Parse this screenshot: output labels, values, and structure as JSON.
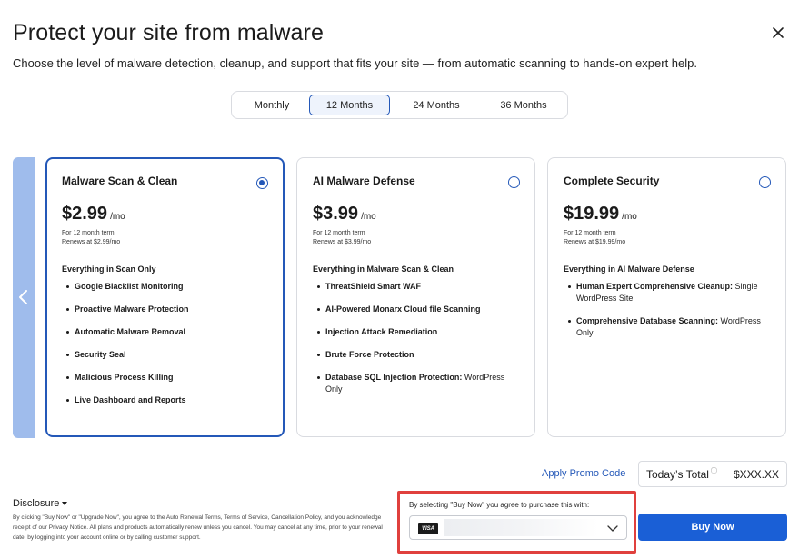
{
  "header": {
    "title": "Protect your site from malware",
    "subtitle": "Choose the level of malware detection, cleanup, and support that fits your site — from automatic scanning to hands-on expert help.",
    "close_icon": "close-icon"
  },
  "terms": {
    "tabs": [
      {
        "label": "Monthly"
      },
      {
        "label": "12 Months"
      },
      {
        "label": "24 Months"
      },
      {
        "label": "36 Months"
      }
    ],
    "selected": "12 Months"
  },
  "carousel": {
    "prev_icon": "chevron-left-icon"
  },
  "plans": [
    {
      "name": "Malware Scan & Clean",
      "selected": true,
      "price": "$2.99",
      "per": "/mo",
      "term_note": "For 12 month term",
      "renew_note": "Renews at $2.99/mo",
      "feature_head": "Everything in Scan Only",
      "features": [
        {
          "bold": "Google Blacklist Monitoring",
          "rest": ""
        },
        {
          "bold": "Proactive Malware Protection",
          "rest": ""
        },
        {
          "bold": "Automatic Malware Removal",
          "rest": ""
        },
        {
          "bold": "Security Seal",
          "rest": ""
        },
        {
          "bold": "Malicious Process Killing",
          "rest": ""
        },
        {
          "bold": "Live Dashboard and Reports",
          "rest": ""
        }
      ]
    },
    {
      "name": "AI Malware Defense",
      "selected": false,
      "price": "$3.99",
      "per": "/mo",
      "term_note": "For 12 month term",
      "renew_note": "Renews at $3.99/mo",
      "feature_head": "Everything in Malware Scan & Clean",
      "features": [
        {
          "bold": "ThreatShield Smart WAF",
          "rest": ""
        },
        {
          "bold": "AI-Powered Monarx Cloud file Scanning",
          "rest": ""
        },
        {
          "bold": "Injection Attack Remediation",
          "rest": ""
        },
        {
          "bold": "Brute Force Protection",
          "rest": ""
        },
        {
          "bold": "Database SQL Injection Protection:",
          "rest": " WordPress Only"
        }
      ]
    },
    {
      "name": "Complete Security",
      "selected": false,
      "price": "$19.99",
      "per": "/mo",
      "term_note": "For 12 month term",
      "renew_note": "Renews at $19.99/mo",
      "feature_head": "Everything in AI Malware Defense",
      "features": [
        {
          "bold": "Human Expert Comprehensive Cleanup:",
          "rest": " Single WordPress Site"
        },
        {
          "bold": "Comprehensive Database Scanning:",
          "rest": " WordPress Only"
        }
      ]
    }
  ],
  "footer": {
    "promo_link": "Apply Promo Code",
    "total_label": "Today’s Total",
    "total_info": "ⓘ",
    "total_value": "$XXX.XX",
    "disclosure_label": "Disclosure",
    "legal_text": "By clicking \"Buy Now\" or \"Upgrade Now\", you agree to the Auto Renewal Terms, Terms of Service, Cancellation Policy, and you acknowledge receipt of our Privacy Notice. All plans and products automatically renew unless you cancel. You may cancel at any time, prior to your renewal date, by logging into your account online or by calling customer support.",
    "pay_note": "By selecting \"Buy Now\" you agree to purchase this with:",
    "card_brand": "VISA",
    "buy_label": "Buy Now"
  },
  "colors": {
    "accent": "#2458b8",
    "button": "#1a5fd6",
    "highlight": "#e0403d",
    "strip": "#9fbcec"
  }
}
